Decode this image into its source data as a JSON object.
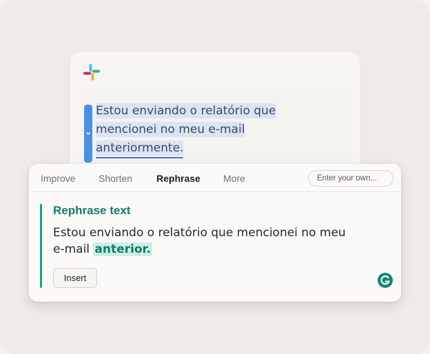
{
  "message": {
    "lines": [
      "Estou enviando o relatório que",
      "mencionei no meu e-mail",
      "anteriormente."
    ]
  },
  "popup": {
    "tabs": [
      {
        "label": "Improve",
        "active": false
      },
      {
        "label": "Shorten",
        "active": false
      },
      {
        "label": "Rephrase",
        "active": true
      },
      {
        "label": "More",
        "active": false
      }
    ],
    "custom_prompt_placeholder": "Enter your own...",
    "suggestion_title": "Rephrase text",
    "suggestion_text_line1": "Estou enviando o relatório que mencionei no meu",
    "suggestion_text_line2_prefix": "e-mail ",
    "suggestion_highlight": "anterior.",
    "insert_label": "Insert"
  },
  "icons": {
    "app_logo": "slack-logo-icon",
    "handle": "chevron-down-icon",
    "assistant_logo": "grammarly-logo-icon"
  },
  "colors": {
    "accent_green": "#0f7d6b",
    "highlight_bg": "#cdeee3",
    "selection_bg": "#dbe4f3",
    "handle_blue": "#4a8fe4"
  }
}
